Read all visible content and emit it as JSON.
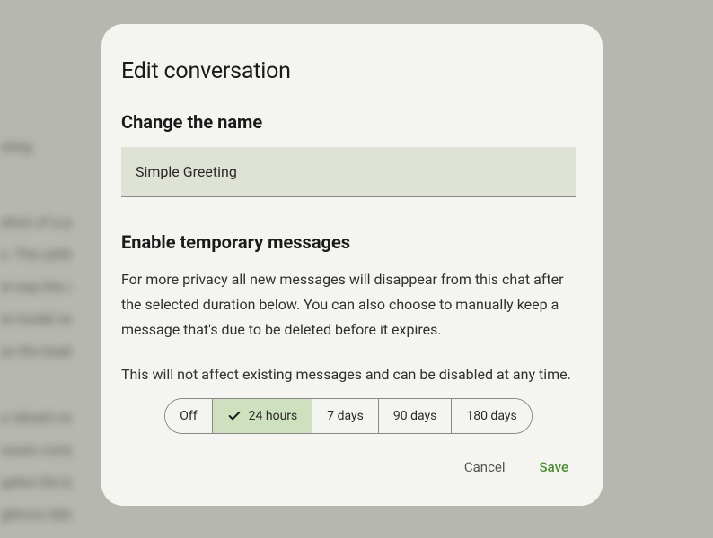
{
  "modal": {
    "title": "Edit conversation",
    "name_section": {
      "heading": "Change the name",
      "value": "Simple Greeting"
    },
    "temp_section": {
      "heading": "Enable temporary messages",
      "description": "For more privacy all new messages will disappear from this chat after the selected duration below. You can also choose to manually keep a message that's due to be deleted before it expires.",
      "note": "This will not affect existing messages and can be disabled at any time.",
      "options": {
        "off": "Off",
        "h24": "24 hours",
        "d7": "7 days",
        "d90": "90 days",
        "d180": "180 days"
      },
      "selected": "24 hours"
    },
    "actions": {
      "cancel": "Cancel",
      "save": "Save"
    }
  }
}
